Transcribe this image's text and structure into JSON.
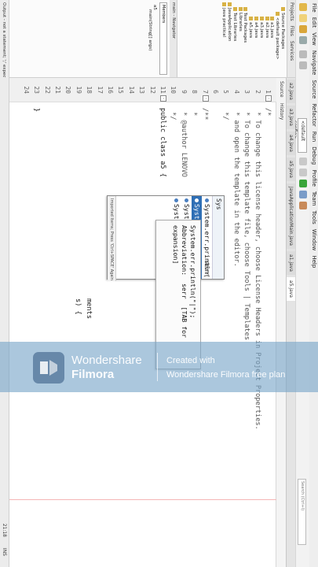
{
  "window": {
    "menus": [
      "File",
      "Edit",
      "View",
      "Navigate",
      "Source",
      "Refactor",
      "Run",
      "Debug",
      "Profile",
      "Team",
      "Tools",
      "Window",
      "Help"
    ],
    "config_combo": "<default config>",
    "search_placeholder": "Search (Ctrl+I)"
  },
  "projects_panel": {
    "tabs": [
      "Projects",
      "Files",
      "Services"
    ],
    "tree": [
      {
        "label": "Source Packages",
        "indent": 1
      },
      {
        "label": "<default package>",
        "indent": 2
      },
      {
        "label": "a1.java",
        "indent": 3
      },
      {
        "label": "a2.java",
        "indent": 3
      },
      {
        "label": "a3.java",
        "indent": 3
      },
      {
        "label": "a4.java",
        "indent": 3
      },
      {
        "label": "a5.java",
        "indent": 3
      },
      {
        "label": "Test Packages",
        "indent": 1
      },
      {
        "label": "Libraries",
        "indent": 1
      },
      {
        "label": "Test Libraries",
        "indent": 1
      },
      {
        "label": "JavaApplication",
        "indent": 0
      },
      {
        "label": "java practical",
        "indent": 0
      }
    ]
  },
  "navigator": {
    "title": "main - Navigator",
    "combo": "Members",
    "items": [
      "a5",
      "main(String[] args)"
    ]
  },
  "editor": {
    "tabs": [
      "a2.java",
      "a3.java",
      "a4.java",
      "a5.java",
      "JavaApplicationMain.java",
      "a1.java",
      "a5.java"
    ],
    "active_tab": "a5.java",
    "toolbar_labels": [
      "Source",
      "History"
    ],
    "line_numbers": [
      "1",
      "2",
      "3",
      "4",
      "5",
      "6",
      "7",
      "8",
      "9",
      "10",
      "11",
      "12",
      "13",
      "14",
      "15",
      "16",
      "17",
      "18",
      "19",
      "20",
      "21",
      "22",
      "23",
      "24"
    ],
    "lines": [
      "/*",
      " * To change this license header, choose License Headers in Project Properties.",
      " * To change this template file, choose Tools | Templates",
      " * and open the template in the editor.",
      " */",
      "",
      "/**",
      " *",
      " * @author LENOVO",
      " */",
      "public class a5 {",
      "",
      "",
      "",
      "",
      "",
      "",
      "",
      "",
      "",
      "",
      "",
      "}",
      ""
    ],
    "partial_tail": "ments",
    "partial_tail2": "s) {",
    "hint_lines": [
      "System.err.println(\"|\");",
      "",
      "Abbreviation:  serr  [TAB for",
      "expansion]"
    ],
    "completion": {
      "typed": "Sys",
      "rows": [
        {
          "text": "System.err.println(\"|\");",
          "abbr": "serr",
          "selected": false
        },
        {
          "text": "System.out.println(className.methodName(); systrace",
          "abbr": "",
          "selected": true
        },
        {
          "text": "System.out.println(\"|\");",
          "abbr": "sout",
          "selected": false
        },
        {
          "text": "System",
          "abbr": "",
          "selected": false
        }
      ],
      "footer": "Imported Items; Press 'Ctrl+SPACE' Again for All Items"
    },
    "caret_position": "21:18",
    "insert_mode": "INS"
  },
  "output": {
    "label": "Output - not a statement; ';' expected"
  },
  "watermark": {
    "brand_line1": "Wondershare",
    "brand_line2": "Filmora",
    "created_with": "Created with",
    "created_by": "Wondershare Filmora free plan"
  }
}
